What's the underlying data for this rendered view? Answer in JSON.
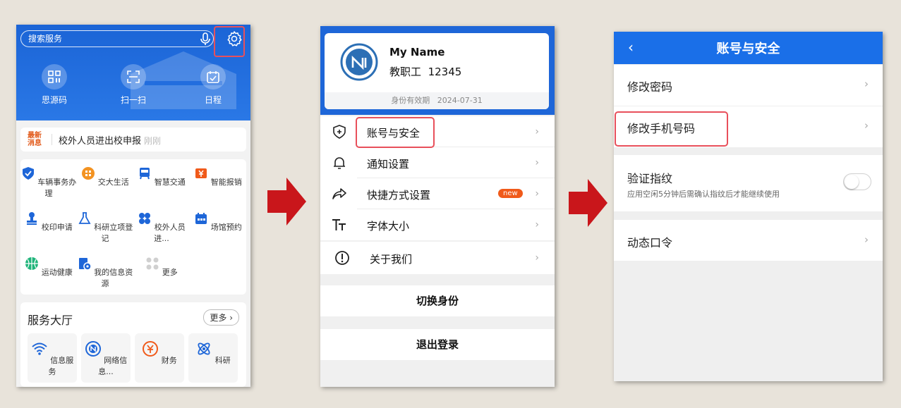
{
  "colors": {
    "accent_blue": "#1e66d8",
    "highlight_red": "#e8505b",
    "arrow_red": "#c9161b",
    "news_orange": "#e25b1c"
  },
  "screen1": {
    "search_placeholder": "搜索服务",
    "quick_actions": [
      {
        "label": "思源码",
        "icon": "qr-code-icon"
      },
      {
        "label": "扫一扫",
        "icon": "scan-icon"
      },
      {
        "label": "日程",
        "icon": "calendar-icon"
      }
    ],
    "news": {
      "tag": "最新消息",
      "text": "校外人员进出校申报",
      "time": "刚刚"
    },
    "grid": [
      {
        "label": "车辆事务办理",
        "icon": "shield-icon"
      },
      {
        "label": "交大生活",
        "icon": "life-icon"
      },
      {
        "label": "智慧交通",
        "icon": "bus-icon"
      },
      {
        "label": "智能报销",
        "icon": "reimburse-icon"
      },
      {
        "label": "校印申请",
        "icon": "seal-icon"
      },
      {
        "label": "科研立项登记",
        "icon": "flask-icon"
      },
      {
        "label": "校外人员进...",
        "icon": "apps-icon"
      },
      {
        "label": "场馆预约",
        "icon": "venue-icon"
      },
      {
        "label": "运动健康",
        "icon": "basketball-icon"
      },
      {
        "label": "我的信息资源",
        "icon": "info-folder-icon"
      },
      {
        "label": "更多",
        "icon": "more-dots-icon"
      }
    ],
    "hall": {
      "title": "服务大厅",
      "more": "更多",
      "cards": [
        {
          "label": "信息服务",
          "icon": "wifi-icon"
        },
        {
          "label": "网络信息...",
          "icon": "network-icon"
        },
        {
          "label": "财务",
          "icon": "yen-icon"
        },
        {
          "label": "科研",
          "icon": "atom-icon"
        }
      ]
    }
  },
  "screen2": {
    "name": "My Name",
    "role": "教职工",
    "id": "12345",
    "valid_label": "身份有效期",
    "valid_date": "2024-07-31",
    "menu": [
      {
        "label": "账号与安全",
        "icon": "shield-plus-icon"
      },
      {
        "label": "通知设置",
        "icon": "bell-icon"
      },
      {
        "label": "快捷方式设置",
        "icon": "share-arrow-icon",
        "badge": "new"
      },
      {
        "label": "字体大小",
        "icon": "font-size-icon"
      },
      {
        "label": "关于我们",
        "icon": "info-circle-icon"
      }
    ],
    "switch_identity": "切换身份",
    "logout": "退出登录"
  },
  "screen3": {
    "title": "账号与安全",
    "change_password": "修改密码",
    "change_phone": "修改手机号码",
    "fingerprint": "验证指纹",
    "fingerprint_desc": "应用空闲5分钟后需确认指纹后才能继续使用",
    "fingerprint_enabled": false,
    "dynamic_token": "动态口令"
  }
}
